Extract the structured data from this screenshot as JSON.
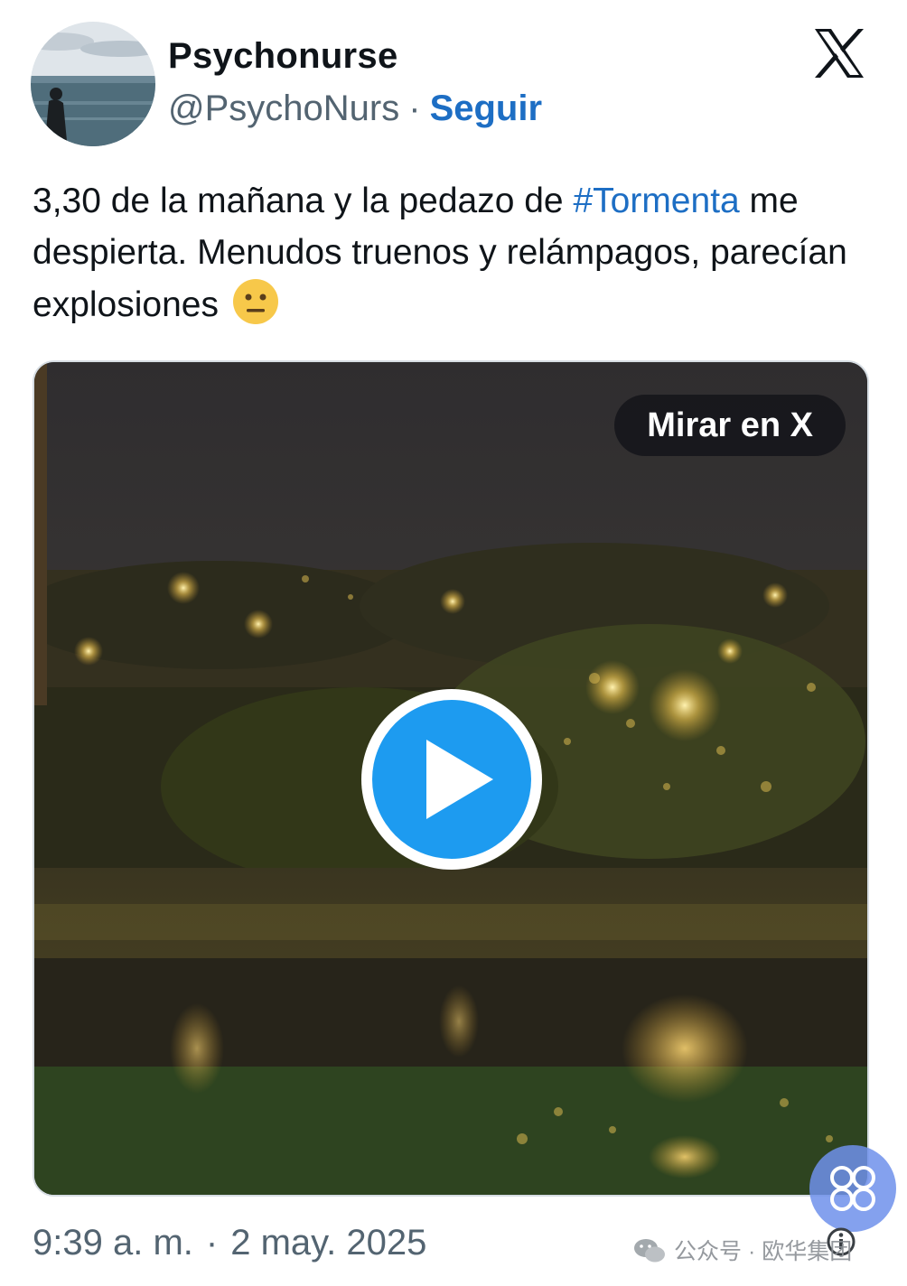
{
  "author": {
    "display_name": "Psychonurse",
    "handle": "@PsychoNurs",
    "separator": "·",
    "follow_label": "Seguir"
  },
  "brand": {
    "logo": "x-logo-icon",
    "color": "#0f1419"
  },
  "tweet": {
    "text_before": "3,30 de la mañana y la pedazo de ",
    "hashtag": "#Tormenta",
    "text_after": " me despierta. Menudos truenos y relámpagos, parecían explosiones ",
    "emoji": "neutral-face-emoji",
    "link_color": "#1d6ec4"
  },
  "media": {
    "watch_label": "Mirar en X",
    "play_icon": "play-icon",
    "play_color": "#1d9bf0"
  },
  "footer": {
    "time": "9:39 a. m.",
    "separator": "·",
    "date": "2 may. 2025",
    "info_icon": "info-icon"
  },
  "watermark": {
    "text": "公众号 · 欧华集团",
    "icon": "wechat-icon"
  },
  "fab": {
    "icon": "grid-circles-icon"
  }
}
